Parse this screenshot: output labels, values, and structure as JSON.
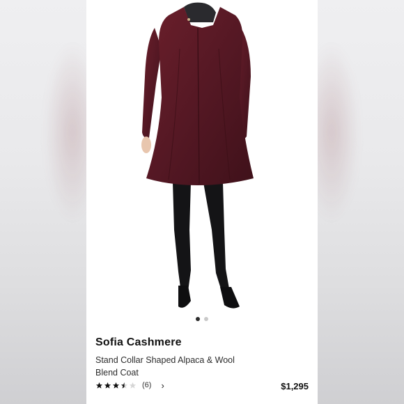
{
  "product": {
    "brand": "Sofia Cashmere",
    "title": "Stand Collar Shaped Alpaca & Wool Blend Coat",
    "rating": 3.5,
    "review_count": "(6)",
    "price": "$1,295"
  },
  "carousel": {
    "total": 2,
    "active": 1
  },
  "colors": {
    "coat": "#5a1a24",
    "star": "#111111"
  }
}
